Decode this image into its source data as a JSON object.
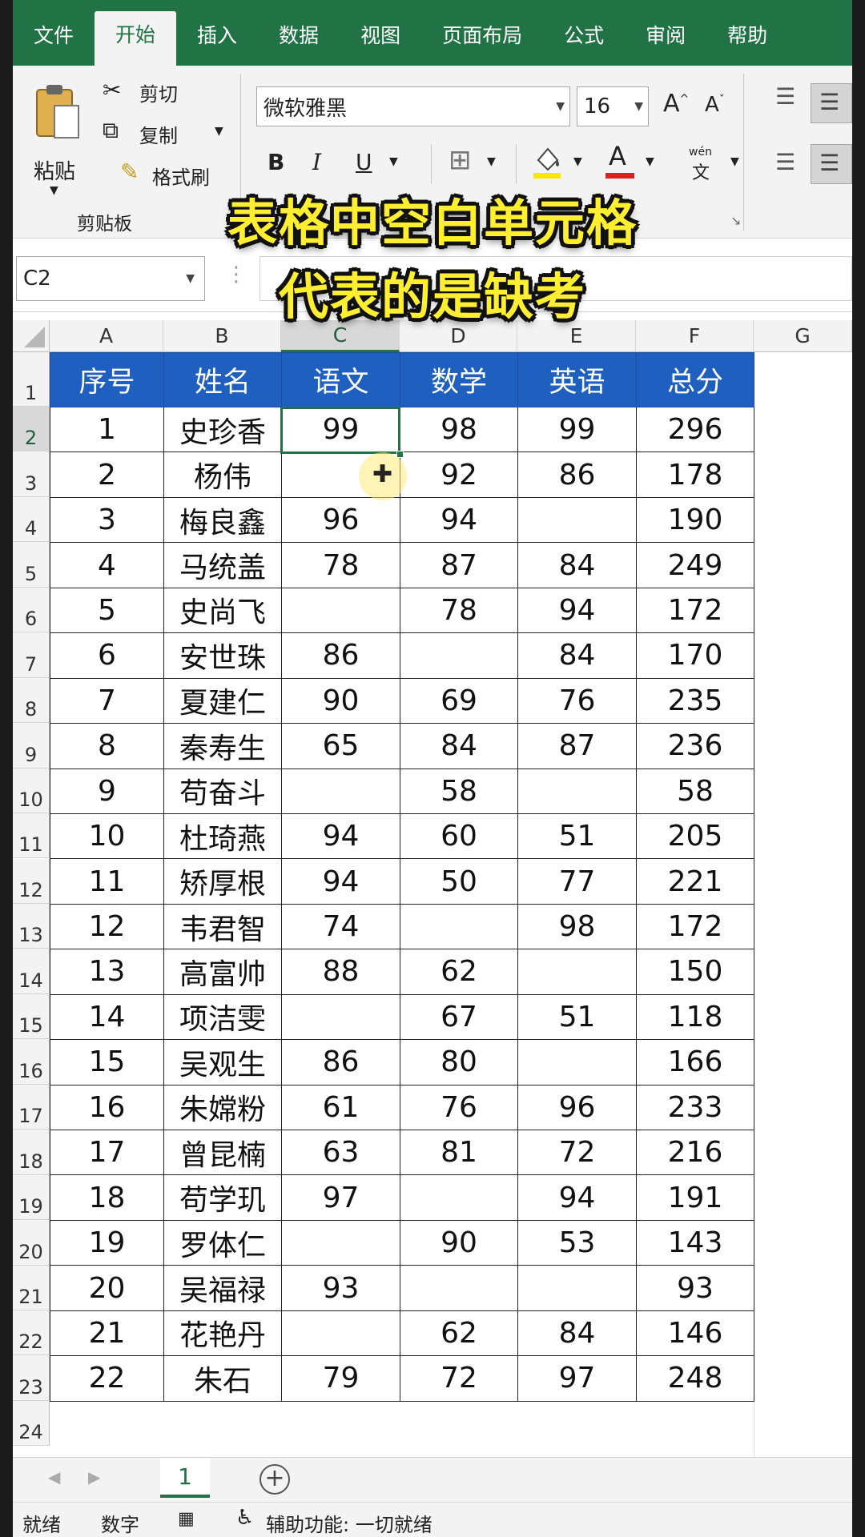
{
  "tabs": [
    "文件",
    "开始",
    "插入",
    "数据",
    "视图",
    "页面布局",
    "公式",
    "审阅",
    "帮助"
  ],
  "active_tab": "开始",
  "clipboard": {
    "paste": "粘贴",
    "cut": "剪切",
    "copy": "复制",
    "format_painter": "格式刷",
    "group_label": "剪贴板"
  },
  "font": {
    "family": "微软雅黑",
    "size": "16",
    "grow": "A",
    "shrink": "A",
    "bold": "B",
    "italic": "I",
    "underline": "U",
    "font_color_glyph": "A",
    "phonetic_top": "wén",
    "phonetic_bottom": "文"
  },
  "name_box": "C2",
  "overlay_caption": [
    "表格中空白单元格",
    "代表的是缺考"
  ],
  "columns": [
    "A",
    "B",
    "C",
    "D",
    "E",
    "F",
    "G"
  ],
  "row_numbers": [
    "1",
    "2",
    "3",
    "4",
    "5",
    "6",
    "7",
    "8",
    "9",
    "10",
    "11",
    "12",
    "13",
    "14",
    "15",
    "16",
    "17",
    "18",
    "19",
    "20",
    "21",
    "22",
    "23",
    "24"
  ],
  "table": {
    "headers": [
      "序号",
      "姓名",
      "语文",
      "数学",
      "英语",
      "总分"
    ],
    "rows": [
      [
        "1",
        "史珍香",
        "99",
        "98",
        "99",
        "296"
      ],
      [
        "2",
        "杨伟",
        "",
        "92",
        "86",
        "178"
      ],
      [
        "3",
        "梅良鑫",
        "96",
        "94",
        "",
        "190"
      ],
      [
        "4",
        "马统盖",
        "78",
        "87",
        "84",
        "249"
      ],
      [
        "5",
        "史尚飞",
        "",
        "78",
        "94",
        "172"
      ],
      [
        "6",
        "安世珠",
        "86",
        "",
        "84",
        "170"
      ],
      [
        "7",
        "夏建仁",
        "90",
        "69",
        "76",
        "235"
      ],
      [
        "8",
        "秦寿生",
        "65",
        "84",
        "87",
        "236"
      ],
      [
        "9",
        "苟奋斗",
        "",
        "58",
        "",
        "58"
      ],
      [
        "10",
        "杜琦燕",
        "94",
        "60",
        "51",
        "205"
      ],
      [
        "11",
        "矫厚根",
        "94",
        "50",
        "77",
        "221"
      ],
      [
        "12",
        "韦君智",
        "74",
        "",
        "98",
        "172"
      ],
      [
        "13",
        "高富帅",
        "88",
        "62",
        "",
        "150"
      ],
      [
        "14",
        "项洁雯",
        "",
        "67",
        "51",
        "118"
      ],
      [
        "15",
        "吴观生",
        "86",
        "80",
        "",
        "166"
      ],
      [
        "16",
        "朱嫦粉",
        "61",
        "76",
        "96",
        "233"
      ],
      [
        "17",
        "曾昆楠",
        "63",
        "81",
        "72",
        "216"
      ],
      [
        "18",
        "苟学玑",
        "97",
        "",
        "94",
        "191"
      ],
      [
        "19",
        "罗体仁",
        "",
        "90",
        "53",
        "143"
      ],
      [
        "20",
        "吴福禄",
        "93",
        "",
        "",
        "93"
      ],
      [
        "21",
        "花艳丹",
        "",
        "62",
        "84",
        "146"
      ],
      [
        "22",
        "朱石",
        "79",
        "72",
        "97",
        "248"
      ]
    ]
  },
  "sheet_tab": "1",
  "status": {
    "ready": "就绪",
    "numeric": "数字",
    "accessibility": "辅助功能: 一切就绪"
  },
  "colors": {
    "excel_green": "#217346",
    "header_blue": "#1f5fbf",
    "caption_yellow": "#ffef30"
  }
}
